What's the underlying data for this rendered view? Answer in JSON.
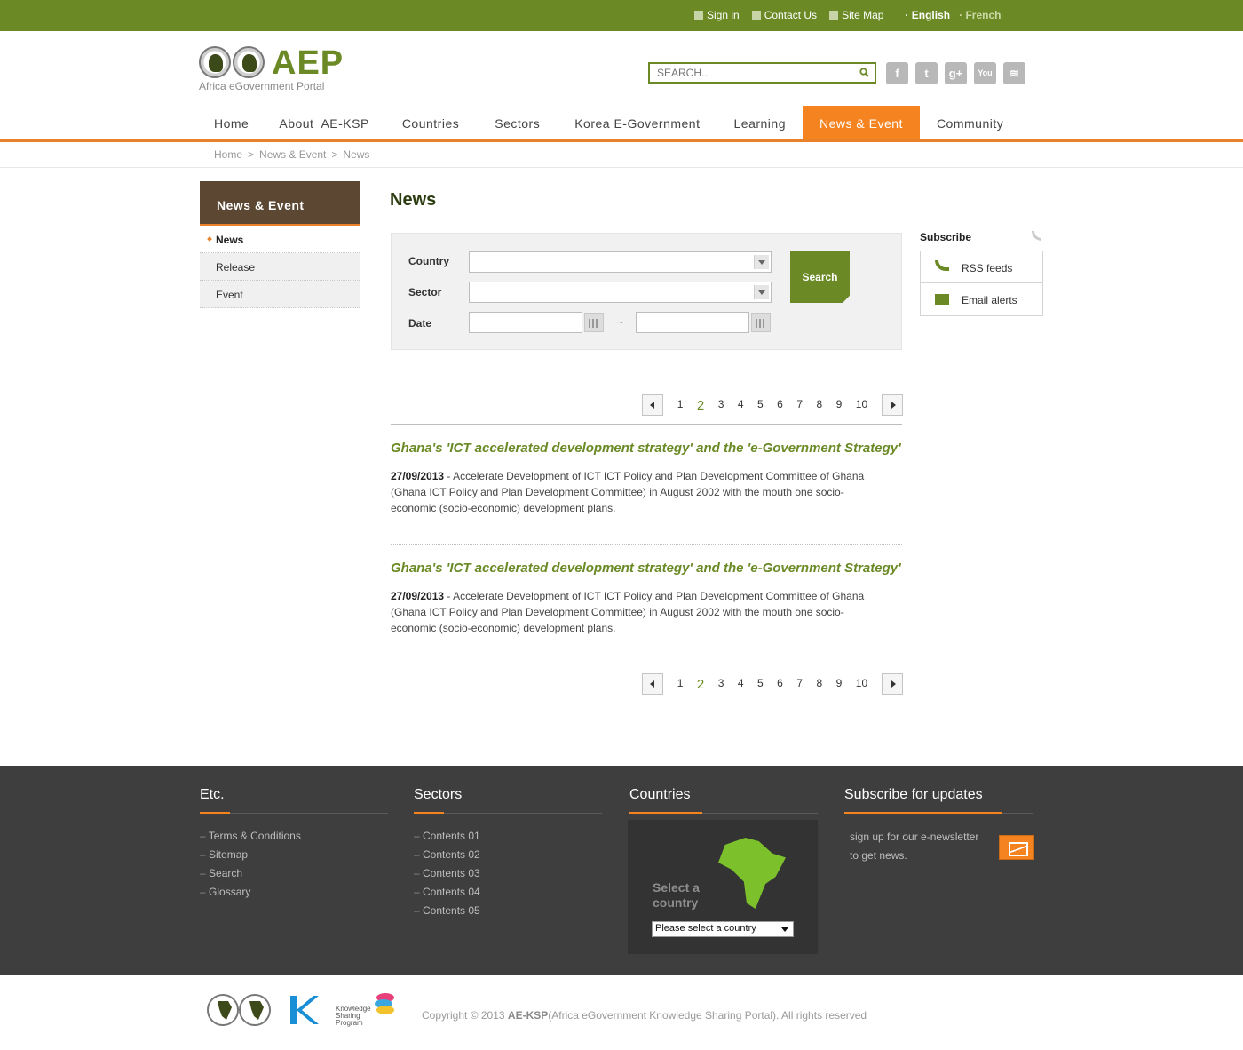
{
  "topbar": {
    "links": [
      {
        "label": "Sign in",
        "icon": "lock-icon"
      },
      {
        "label": "Contact Us",
        "icon": "document-icon"
      },
      {
        "label": "Site Map",
        "icon": "sitemap-icon"
      }
    ],
    "languages": [
      "English",
      "French"
    ]
  },
  "logo": {
    "text": "AEP",
    "subtitle": "Africa eGovernment Portal"
  },
  "search": {
    "placeholder": "SEARCH..."
  },
  "social": [
    {
      "name": "facebook-icon",
      "glyph": "f"
    },
    {
      "name": "twitter-icon",
      "glyph": "t"
    },
    {
      "name": "google-plus-icon",
      "glyph": "g+"
    },
    {
      "name": "youtube-icon",
      "glyph": "You"
    },
    {
      "name": "rss-icon",
      "glyph": "≋"
    }
  ],
  "nav": [
    "Home",
    "About  AE-KSP",
    "Countries",
    "Sectors",
    "Korea E-Government",
    "Learning",
    "News & Event",
    "Community"
  ],
  "nav_active": "News & Event",
  "breadcrumb": [
    "Home",
    ">",
    "News & Event",
    ">",
    "News"
  ],
  "sidebar": {
    "title": "News & Event",
    "items": [
      "News",
      "Release",
      "Event"
    ]
  },
  "page_title": "News",
  "filter": {
    "country_label": "Country",
    "sector_label": "Sector",
    "date_label": "Date",
    "tilde": "~",
    "search_button": "Search"
  },
  "subscribe": {
    "title": "Subscribe",
    "rss": "RSS feeds",
    "email": "Email alerts"
  },
  "pagination": {
    "pages": [
      "1",
      "2",
      "3",
      "4",
      "5",
      "6",
      "7",
      "8",
      "9",
      "10"
    ],
    "current": "2"
  },
  "articles": [
    {
      "title": "Ghana's 'ICT accelerated development strategy' and the 'e-Government Strategy'",
      "date": "27/09/2013",
      "text": " - Accelerate Development of ICT ICT Policy and Plan Development Committee of Ghana (Ghana ICT Policy and Plan Development Committee) in August 2002 with the mouth one socio-economic (socio-economic) development plans."
    },
    {
      "title": "Ghana's 'ICT accelerated development strategy' and the 'e-Government Strategy'",
      "date": "27/09/2013",
      "text": " - Accelerate Development of ICT ICT Policy and Plan Development Committee of Ghana (Ghana ICT Policy and Plan Development Committee) in August 2002 with the mouth one socio-economic (socio-economic) development plans."
    }
  ],
  "footer": {
    "etc": {
      "title": "Etc.",
      "items": [
        "Terms & Conditions",
        "Sitemap",
        "Search",
        "Glossary"
      ]
    },
    "sectors": {
      "title": "Sectors",
      "items": [
        "Contents 01",
        "Contents 02",
        "Contents 03",
        "Contents 04",
        "Contents 05"
      ]
    },
    "countries": {
      "title": "Countries",
      "select_text": "Select a country",
      "select_value": "Please select a country"
    },
    "subscribe": {
      "title": "Subscribe for updates",
      "text": "sign up for our e-newsletter to get news."
    }
  },
  "bottom": {
    "ksp_text": "Knowledge Sharing Program",
    "copyright_prefix": "Copyright © 2013 ",
    "copyright_brand": "AE-KSP",
    "copyright_suffix": "(Africa eGovernment Knowledge Sharing Portal). All rights reserved"
  },
  "colors": {
    "brand_green": "#6b8a26",
    "accent_orange": "#f5831f",
    "sidebar_brown": "#5b4732",
    "footer_bg": "#3e3e3e"
  }
}
